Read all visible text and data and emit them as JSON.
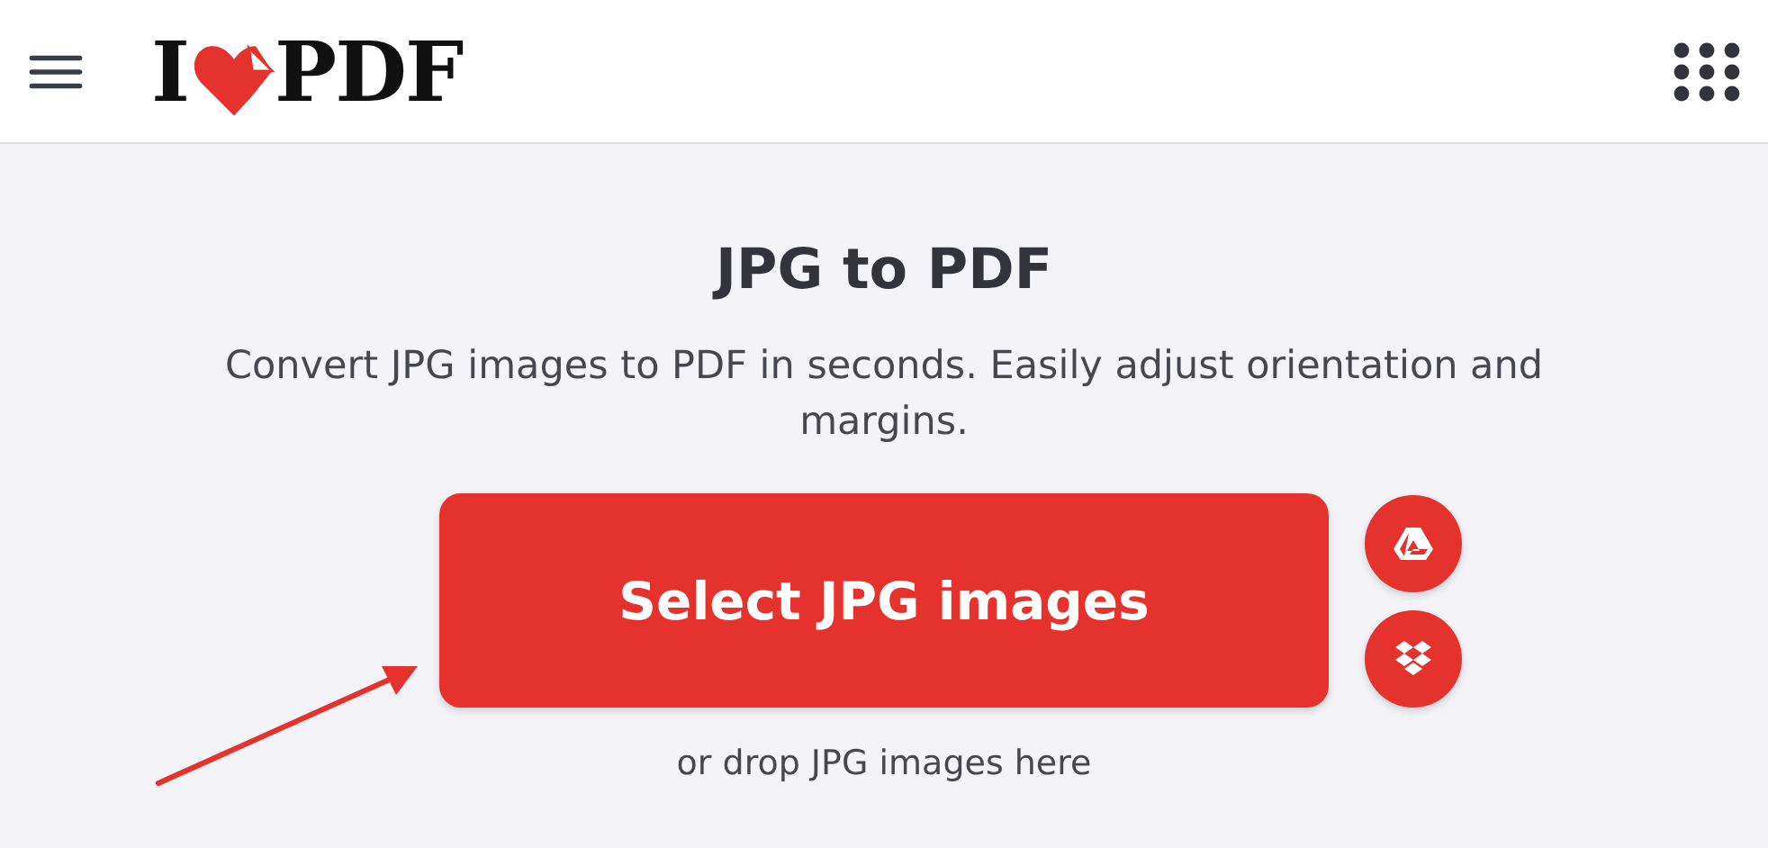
{
  "header": {
    "logo": {
      "left": "I",
      "right": "PDF"
    }
  },
  "tool": {
    "title": "JPG to PDF",
    "description": "Convert JPG images to PDF in seconds. Easily adjust orientation and margins.",
    "select_button": "Select JPG images",
    "drop_hint": "or drop JPG images here"
  }
}
